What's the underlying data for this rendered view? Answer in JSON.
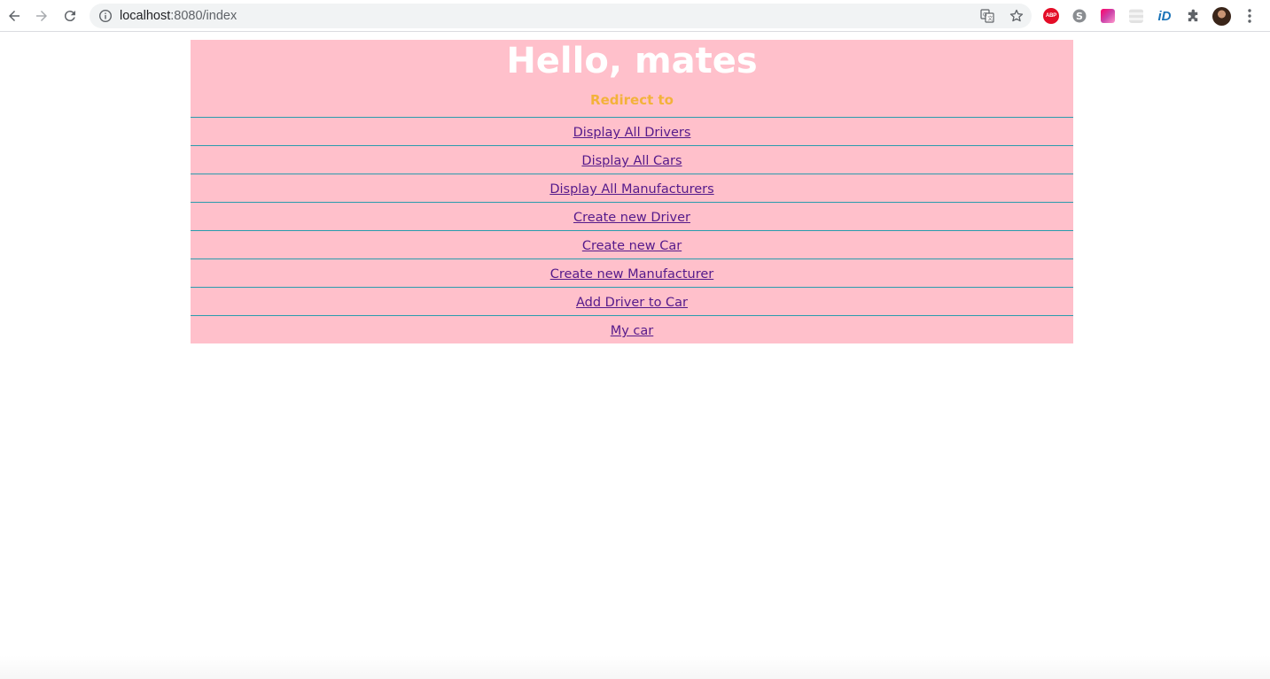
{
  "browser": {
    "url_host": "localhost",
    "url_rest": ":8080/index",
    "icons": {
      "back": "back-arrow-icon",
      "forward": "forward-arrow-icon",
      "reload": "reload-icon",
      "info": "info-icon",
      "translate": "translate-icon",
      "bookmark": "star-icon",
      "abp": "adblock-plus-icon",
      "skype": "skype-icon",
      "gradient_ext": "color-extension-icon",
      "grid_ext": "grid-extension-icon",
      "id_ext": "id-extension-icon",
      "extensions": "puzzle-piece-icon",
      "profile": "profile-avatar",
      "menu": "more-vert-icon"
    },
    "abp_label": "ABP",
    "id_ext_label": "iD"
  },
  "page": {
    "title": "Hello, mates",
    "subtitle": "Redirect to",
    "links": [
      {
        "label": "Display All Drivers"
      },
      {
        "label": "Display All Cars"
      },
      {
        "label": "Display All Manufacturers"
      },
      {
        "label": "Create new Driver"
      },
      {
        "label": "Create new Car"
      },
      {
        "label": "Create new Manufacturer"
      },
      {
        "label": "Add Driver to Car"
      },
      {
        "label": "My car"
      }
    ]
  },
  "colors": {
    "panel_background": "#ffc0cb",
    "title_color": "#ffffff",
    "subtitle_color": "#f3b23a",
    "link_color": "#551a8b",
    "row_border": "#2a9cad"
  }
}
